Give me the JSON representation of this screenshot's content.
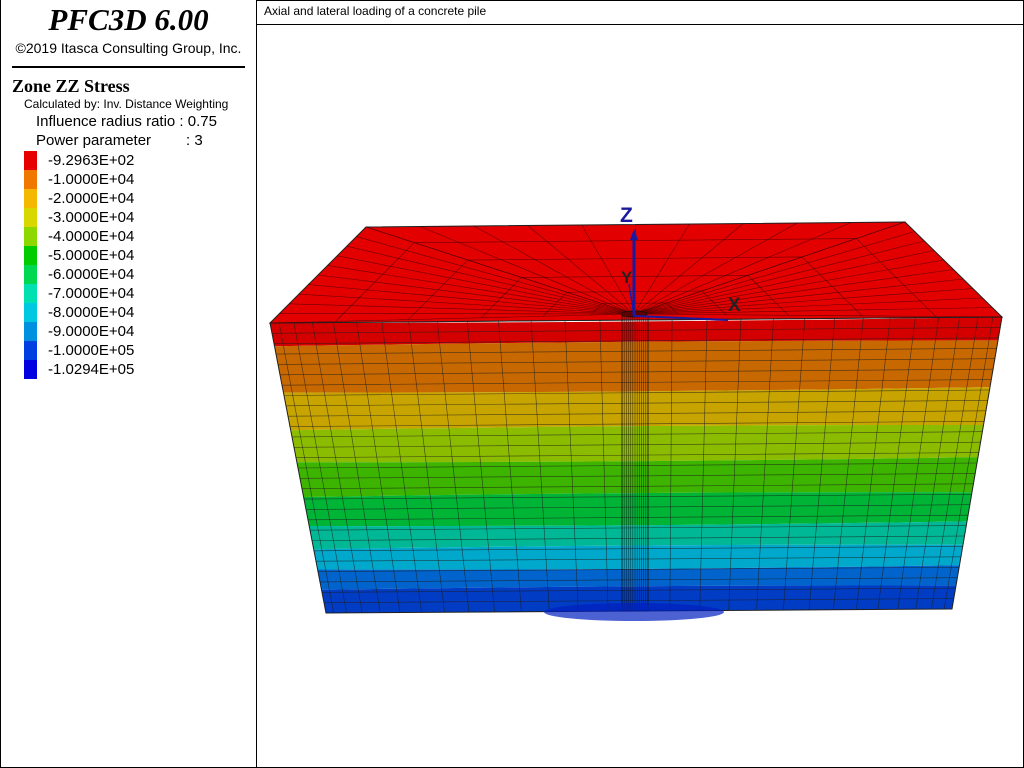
{
  "app": {
    "name": "PFC3D 6.00",
    "copyright": "©2019 Itasca Consulting Group, Inc."
  },
  "plot": {
    "title": "Axial and lateral loading of a concrete pile"
  },
  "legend": {
    "heading": "Zone ZZ Stress",
    "calculated_by": "Calculated by: Inv. Distance Weighting",
    "influence": "Influence radius ratio : 0.75",
    "power_label": "Power parameter",
    "power_value": ": 3",
    "items": [
      {
        "label": "-9.2963E+02",
        "color": "#e60000"
      },
      {
        "label": "-1.0000E+04",
        "color": "#f07800"
      },
      {
        "label": "-2.0000E+04",
        "color": "#f5b800"
      },
      {
        "label": "-3.0000E+04",
        "color": "#d8d800"
      },
      {
        "label": "-4.0000E+04",
        "color": "#8cd800"
      },
      {
        "label": "-5.0000E+04",
        "color": "#00cc00"
      },
      {
        "label": "-6.0000E+04",
        "color": "#00d850"
      },
      {
        "label": "-7.0000E+04",
        "color": "#00e0b0"
      },
      {
        "label": "-8.0000E+04",
        "color": "#00c8e0"
      },
      {
        "label": "-9.0000E+04",
        "color": "#0090e0"
      },
      {
        "label": "-1.0000E+05",
        "color": "#0040e0"
      },
      {
        "label": "-1.0294E+05",
        "color": "#0000e0"
      }
    ]
  },
  "axes": {
    "x": "X",
    "y": "Y",
    "z": "Z",
    "color": "#1a1aa0"
  },
  "model_bands": [
    "#d40000",
    "#c86800",
    "#c8a400",
    "#8cbc00",
    "#3cb400",
    "#00b436",
    "#00b896",
    "#00a8cc",
    "#0064cc",
    "#003cc4"
  ]
}
